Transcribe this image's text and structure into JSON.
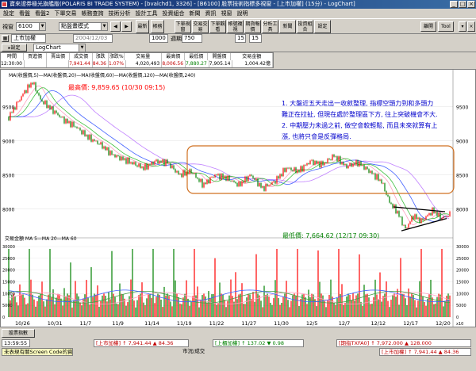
{
  "window": {
    "title": "寶來證券極光旗艦版(POLARIS BI TRADE SYSTEM) - [bvalchd1, 3326] - [B6100] 股票技術指標多視窗 - [上市加權] (15分) - LogChart]"
  },
  "menu": [
    "設定",
    "看盤",
    "看盤2",
    "下單交易",
    "帳務查詢",
    "技術分析",
    "設計工具",
    "投資組合",
    "新聞",
    "資訊",
    "視窗",
    "說明"
  ],
  "toolbar": {
    "page_label": "視窗",
    "page_value": "6100",
    "mode_value": "點盤畫模式",
    "btn_top_left": "最新",
    "btn_top_right": "帳務",
    "btn_a": "下單視窗",
    "btn_b": "交易交易",
    "btn_c": "下單觀看",
    "btn_d": "帳號複視",
    "btn_e": "期貨報價",
    "btn_f": "分析工具",
    "btn_g": "新聞",
    "btn_h": "投資組合",
    "btn_i": "設定",
    "btn_j": "離開",
    "btn_k": "Tool"
  },
  "toolbar2": {
    "symbol": "上市加權",
    "date": "2004/12/03",
    "interval": "1000",
    "period_label": "週期",
    "period_value": "750",
    "freq": "15",
    "freq2": "15",
    "chart_label": "LogChart"
  },
  "info_table": {
    "headers": [
      "時間",
      "買進價",
      "賣出價",
      "成交價",
      "漲跌",
      "漲跌%",
      "交易量",
      "最高價",
      "最低價",
      "開盤價",
      "交易金額"
    ],
    "values": [
      "12:30:00",
      "",
      "",
      "7,941.44",
      "84.36",
      "1.07%",
      "4,020,493",
      "8,006.56",
      "7,880.27",
      "7,905.14",
      "1,004.42億"
    ]
  },
  "chart": {
    "indicator_line": "MA(收盤價,5)—MA(收盤價,20)—MA(收盤價,60)—MA(收盤價,120)—MA(收盤價,240)",
    "high_label": "最高價: 9,859.65 (10/30 09:15)",
    "low_label": "最低價: 7,664.62 (12/17 09:30)",
    "volume_title": "交易金額 MA 5—MA 20—MA 60",
    "annotation_lines": [
      "1. 大盤近五天走出一收斂整理, 指標空頭力到和多頭力",
      "   難正在拉扯, 但現在處於整理區下方, 往上突破機會不大.",
      "2. 中期壓力未過之前, 做空會較輕鬆, 而且未來就算有上",
      "   漲, 也將只會是反彈格局."
    ],
    "annotation_color": "#0000cc",
    "up_color": "#ff0000",
    "down_color": "#008000",
    "box_color": "#d07020",
    "price_ticks": [
      "9500",
      "9000",
      "8500",
      "8000"
    ],
    "volume_ticks": [
      "30000",
      "25000",
      "20000",
      "15000",
      "10000",
      "5000",
      "0"
    ],
    "volume_unit": "x10",
    "date_ticks": [
      "10/26",
      "10/31",
      "11/7",
      "11/9",
      "11/14",
      "11/19",
      "11/22",
      "11/27",
      "11/30",
      "12/5",
      "12/7",
      "12/12",
      "12/17",
      "12/20"
    ]
  },
  "statusbar": {
    "tab1": "股票指數",
    "time": "13:59:55",
    "q1": "[上市加權] ↑ 7,941.44 ▲ 84.36",
    "q2": "[上櫃加權] ↑ 137.02 ▼ 0.98",
    "q3": "[期指TXFA0] ↑ 7,972.000 ▲ 128.000",
    "q4": "[上市加權] ↑ 7,941.44 ▲ 84.36",
    "ticker": "未表現有關Screen Code的資料",
    "market_label": "市況/成交"
  }
}
